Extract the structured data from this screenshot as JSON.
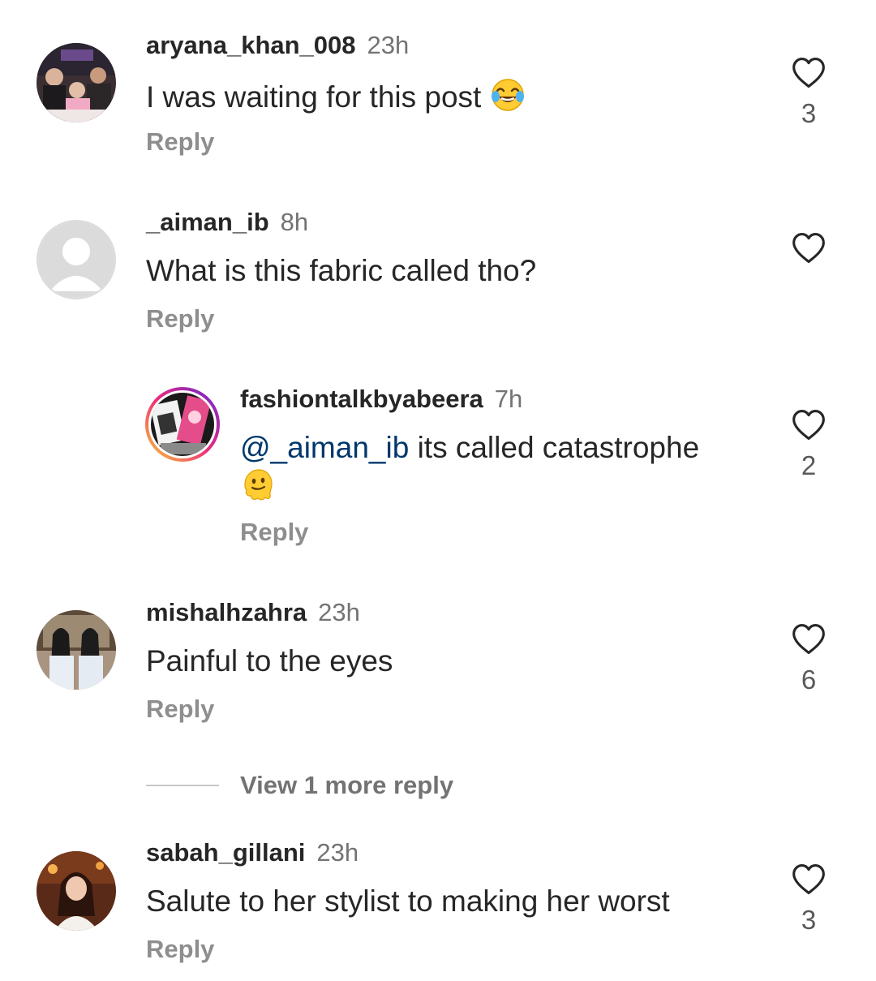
{
  "comments": [
    {
      "username": "aryana_khan_008",
      "time": "23h",
      "text": "I was waiting for this post ",
      "emoji": "laughing-tears",
      "reply_label": "Reply",
      "likes": "3"
    },
    {
      "username": "_aiman_ib",
      "time": "8h",
      "text": "What is this fabric called tho?",
      "reply_label": "Reply",
      "likes": ""
    },
    {
      "username": "fashiontalkbyabeera",
      "time": "7h",
      "mention": "@_aiman_ib",
      "text": " its called catastrophe",
      "emoji": "melting-face",
      "reply_label": "Reply",
      "likes": "2"
    },
    {
      "username": "mishalhzahra",
      "time": "23h",
      "text": "Painful to the eyes",
      "reply_label": "Reply",
      "likes": "6"
    },
    {
      "username": "sabah_gillani",
      "time": "23h",
      "text": "Salute to her stylist to making her worst",
      "reply_label": "Reply",
      "likes": "3"
    }
  ],
  "view_more": {
    "label": "View 1 more reply"
  },
  "colors": {
    "username": "#262626",
    "secondary": "#737373",
    "mention": "#00376b",
    "story_ring_start": "#f9ce34",
    "story_ring_mid": "#ee2a7b",
    "story_ring_end": "#6228d7"
  }
}
